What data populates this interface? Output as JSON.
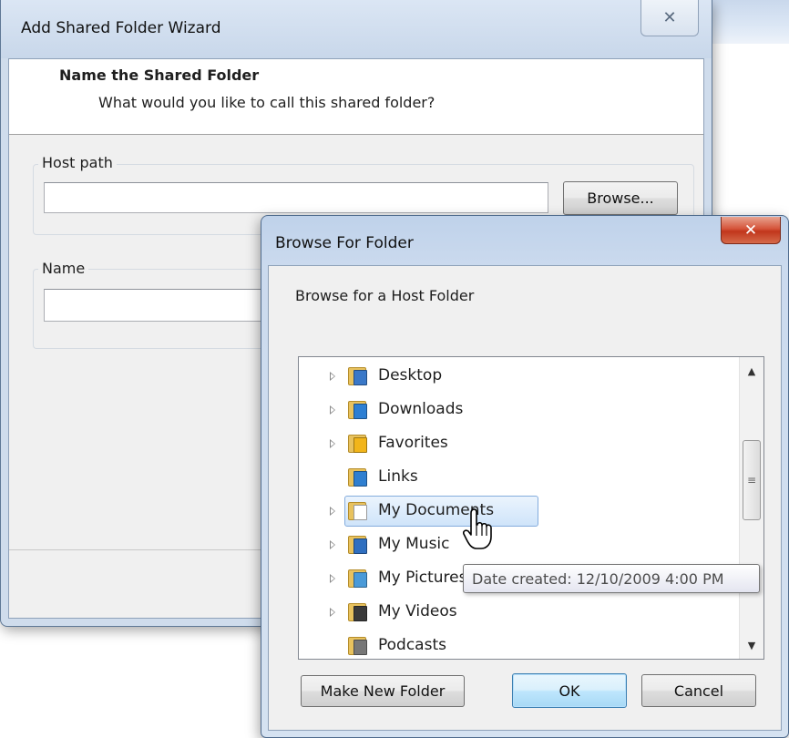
{
  "wizard": {
    "title": "Add Shared Folder Wizard",
    "close_glyph": "✕",
    "header_title": "Name the Shared Folder",
    "header_subtitle": "What would you like to call this shared folder?",
    "host_path_label": "Host path",
    "host_path_value": "",
    "browse_label": "Browse...",
    "name_label": "Name",
    "name_value": ""
  },
  "browse_dialog": {
    "title": "Browse For Folder",
    "close_glyph": "✕",
    "description": "Browse for a Host Folder",
    "tree_items": [
      {
        "label": "Desktop",
        "expandable": true,
        "selected": false,
        "icon": "desktop-folder-icon",
        "accent": "#3a78c8"
      },
      {
        "label": "Downloads",
        "expandable": true,
        "selected": false,
        "icon": "downloads-folder-icon",
        "accent": "#2d7fd3"
      },
      {
        "label": "Favorites",
        "expandable": true,
        "selected": false,
        "icon": "favorites-folder-icon",
        "accent": "#f2b51a"
      },
      {
        "label": "Links",
        "expandable": false,
        "selected": false,
        "icon": "links-folder-icon",
        "accent": "#2f7fd0"
      },
      {
        "label": "My Documents",
        "expandable": true,
        "selected": true,
        "icon": "documents-folder-icon",
        "accent": "#ffffff"
      },
      {
        "label": "My Music",
        "expandable": true,
        "selected": false,
        "icon": "music-folder-icon",
        "accent": "#2f6fc0"
      },
      {
        "label": "My Pictures",
        "expandable": true,
        "selected": false,
        "icon": "pictures-folder-icon",
        "accent": "#4a9ad8"
      },
      {
        "label": "My Videos",
        "expandable": true,
        "selected": false,
        "icon": "videos-folder-icon",
        "accent": "#3a3a3a"
      },
      {
        "label": "Podcasts",
        "expandable": false,
        "selected": false,
        "icon": "podcasts-folder-icon",
        "accent": "#777777"
      }
    ],
    "tooltip": "Date created: 12/10/2009 4:00 PM",
    "make_new_folder_label": "Make New Folder",
    "ok_label": "OK",
    "cancel_label": "Cancel"
  },
  "colors": {
    "selection_border": "#84acdd",
    "close_red": "#c1361c",
    "title_glass": "#cfdcec"
  }
}
